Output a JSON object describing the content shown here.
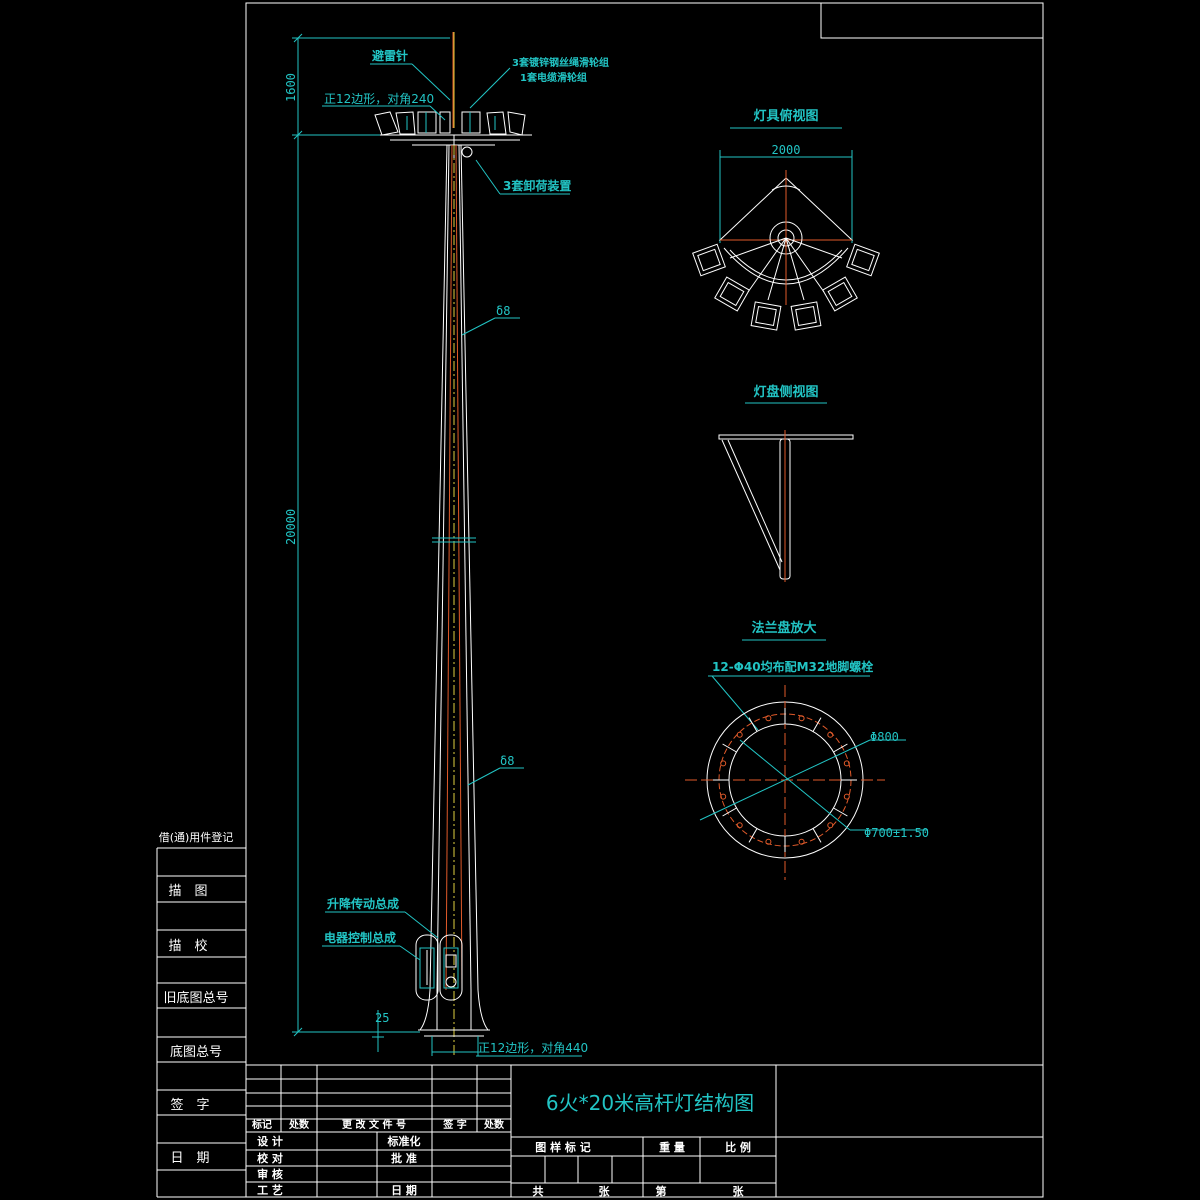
{
  "title": "6火*20米高杆灯结构图",
  "elevation": {
    "labels": {
      "lightning_rod": "避雷针",
      "hoist_set": "3套镀锌钢丝绳滑轮组",
      "cable_pulley": "1套电缆滑轮组",
      "top_polygon": "正12边形，对角240",
      "unload_device": "3套卸荷装置",
      "thickness_upper": "δ8",
      "thickness_lower": "δ8",
      "lifting_drive": "升降传动总成",
      "electrical_control": "电器控制总成",
      "base_polygon": "正12边形，对角440"
    },
    "dimensions": {
      "top": "1600",
      "height": "20000",
      "base": "25"
    }
  },
  "views": {
    "top_view": {
      "title": "灯具俯视图",
      "dim": "2000"
    },
    "side_view": {
      "title": "灯盘侧视图"
    },
    "flange": {
      "title": "法兰盘放大",
      "bolt_note": "12-Φ40均布配M32地脚螺栓",
      "outer_dia": "Φ800",
      "bolt_circle": "Φ700±1.50"
    }
  },
  "left_column": {
    "items": [
      "借(通)用件登记",
      "描　图",
      "描　校",
      "旧底图总号",
      "底图总号",
      "签　字",
      "日　期"
    ]
  },
  "title_block": {
    "rev_headers": [
      "标记",
      "处数",
      "更 改 文 件 号",
      "签 字",
      "处数"
    ],
    "left_rows": [
      [
        "设 计",
        "",
        "标准化",
        ""
      ],
      [
        "校 对",
        "",
        "批 准",
        ""
      ],
      [
        "审 核",
        "",
        "",
        ""
      ],
      [
        "工 艺",
        "",
        "日 期",
        ""
      ]
    ],
    "right_headers": [
      "图 样 标 记",
      "重 量",
      "比 例"
    ],
    "sheet_row": [
      "共",
      "张",
      "第",
      "张"
    ]
  }
}
